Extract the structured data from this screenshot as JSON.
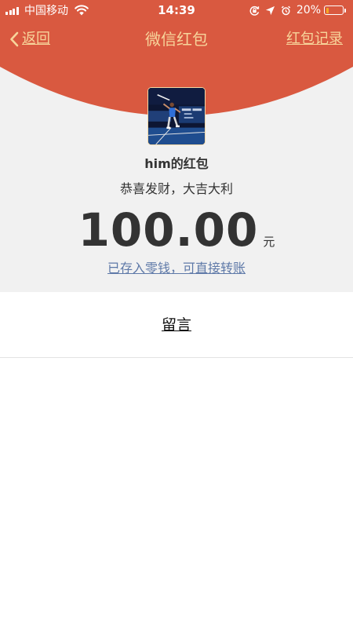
{
  "status_bar": {
    "carrier": "中国移动",
    "time": "14:39",
    "battery_percent": "20%",
    "battery_level": 0.2,
    "icons": [
      "signal-icon",
      "wifi-icon",
      "rotation-lock-icon",
      "location-icon",
      "alarm-icon",
      "battery-icon"
    ]
  },
  "nav": {
    "back_label": "返回",
    "title": "微信红包",
    "records_label": "红包记录"
  },
  "packet": {
    "sender_name": "him的红包",
    "greeting": "恭喜发财，大吉大利",
    "amount": "100.00",
    "unit": "元",
    "change_link": "已存入零钱，可直接转账"
  },
  "message": {
    "label": "留言"
  },
  "colors": {
    "header_red": "#d95940",
    "gold_text": "#f7d59b",
    "link_blue": "#5e79a8",
    "gray_bg": "#f1f1f1"
  }
}
